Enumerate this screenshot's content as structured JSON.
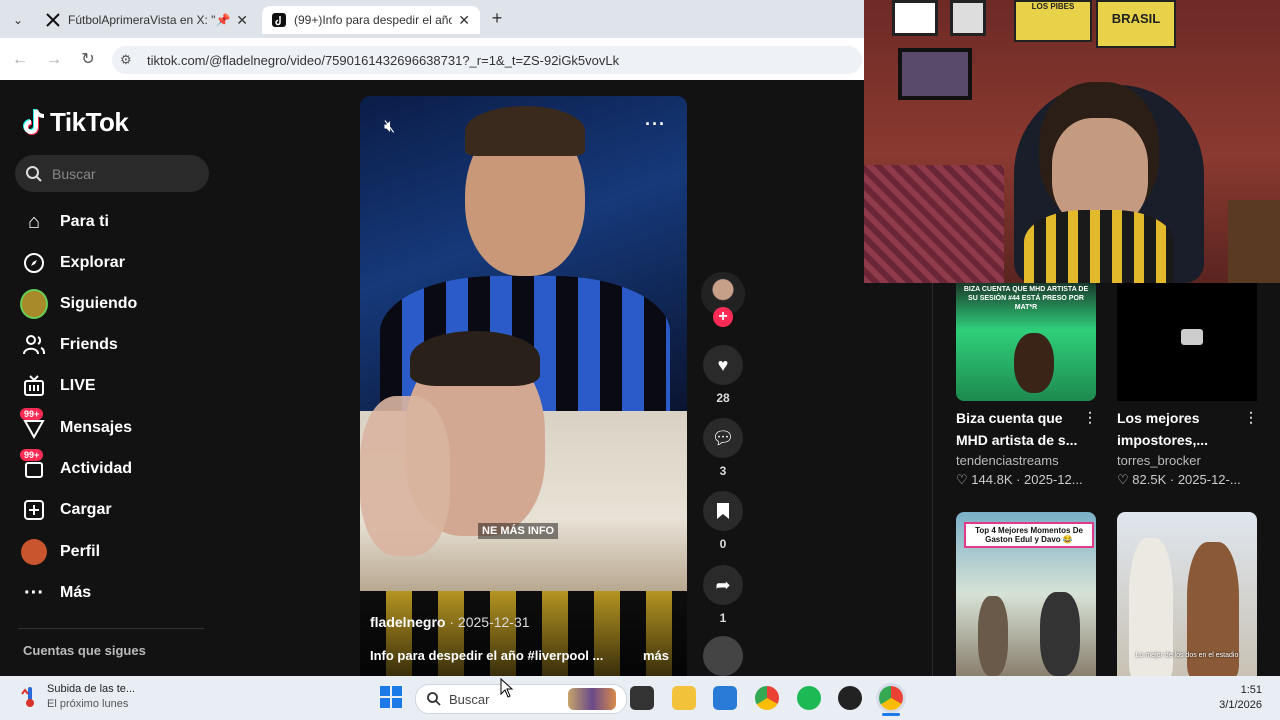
{
  "browser": {
    "tabs": [
      {
        "title": "FútbolAprimeraVista en X: \"📌",
        "favicon": "x-logo-icon",
        "active": false
      },
      {
        "title": "(99+)Info para despedir el año",
        "favicon": "tiktok-icon",
        "active": true
      }
    ],
    "url": "tiktok.com/@fladelnegro/video/7590161432696638731?_r=1&_t=ZS-92iGk5vovLk"
  },
  "sidebar": {
    "logo": "TikTok",
    "search_placeholder": "Buscar",
    "items": [
      {
        "label": "Para ti",
        "icon": "home-icon"
      },
      {
        "label": "Explorar",
        "icon": "compass-icon"
      },
      {
        "label": "Siguiendo",
        "icon": "following-avatar-icon"
      },
      {
        "label": "Friends",
        "icon": "friends-icon"
      },
      {
        "label": "LIVE",
        "icon": "live-tv-icon"
      },
      {
        "label": "Mensajes",
        "icon": "messages-icon",
        "badge": "99+"
      },
      {
        "label": "Actividad",
        "icon": "activity-icon",
        "badge": "99+"
      },
      {
        "label": "Cargar",
        "icon": "upload-plus-icon"
      },
      {
        "label": "Perfil",
        "icon": "profile-avatar-icon"
      },
      {
        "label": "Más",
        "icon": "more-dots-icon"
      }
    ],
    "following_heading": "Cuentas que sigues"
  },
  "video": {
    "overlay_text": "NE MÁS INFO",
    "author": "fladelnegro",
    "date": "2025-12-31",
    "caption": "Info para despedir el año #liverpool ...",
    "more": "más",
    "actions": {
      "likes": "28",
      "comments": "3",
      "saves": "0",
      "shares": "1"
    }
  },
  "recommended": [
    {
      "thumb_text": "BIZA CUENTA QUE MHD ARTISTA DE SU SESIÓN #44 ESTÁ PRESO POR MAT*R",
      "title_line1": "Biza cuenta que",
      "title_line2": "MHD artista de s...",
      "user": "tendenciastreams",
      "likes": "144.8K",
      "date": "2025-12..."
    },
    {
      "thumb_text": "",
      "title_line1": "Los mejores",
      "title_line2": "impostores,...",
      "user": "torres_brocker",
      "likes": "82.5K",
      "date": "2025-12-..."
    },
    {
      "thumb_text": "Top 4 Mejores Momentos De Gaston Edul y Davo 😂"
    },
    {
      "thumb_text": "Lo mejor de los dos en el estadio"
    }
  ],
  "webcam": {
    "poster_1": "LOS PIBES",
    "poster_2": "BRASIL"
  },
  "taskbar": {
    "weather_title": "Subida de las te...",
    "weather_sub": "El próximo lunes",
    "search_placeholder": "Buscar",
    "time": "1:51",
    "date": "3/1/2026"
  },
  "colors": {
    "tiktok_accent": "#fe2c55",
    "taskbar_bg": "#e9eef5"
  }
}
